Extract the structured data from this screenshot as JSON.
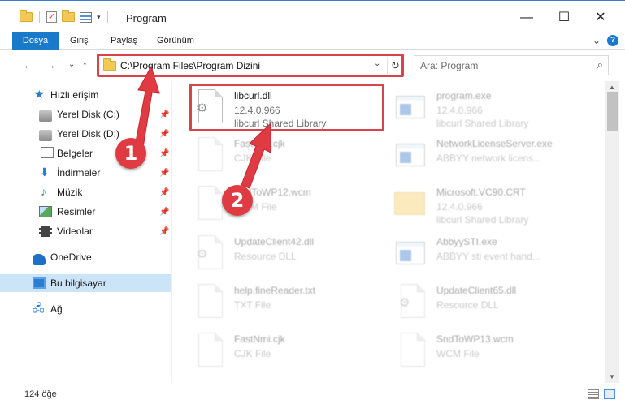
{
  "window": {
    "title": "Program",
    "minimize": "—",
    "maximize": "☐",
    "close": "✕"
  },
  "ribbon": {
    "tabs": [
      "Dosya",
      "Giriş",
      "Paylaş",
      "Görünüm"
    ],
    "expand": "⌄",
    "help": "?"
  },
  "nav": {
    "back": "←",
    "forward": "→",
    "recent": "⌄",
    "up": "↑"
  },
  "address": {
    "path": "C:\\Program Files\\Program Dizini",
    "dropdown": "⌄",
    "refresh": "↻"
  },
  "search": {
    "placeholder": "Ara: Program",
    "icon": "search-icon"
  },
  "sidebar": {
    "items": [
      {
        "label": "Hızlı erişim",
        "icon": "quick-access-star-icon",
        "pinned": false
      },
      {
        "label": "Yerel Disk (C:)",
        "icon": "disk-icon",
        "pinned": true
      },
      {
        "label": "Yerel Disk (D:)",
        "icon": "disk-icon",
        "pinned": true
      },
      {
        "label": "Belgeler",
        "icon": "documents-icon",
        "pinned": true
      },
      {
        "label": "İndirmeler",
        "icon": "downloads-icon",
        "pinned": true
      },
      {
        "label": "Müzik",
        "icon": "music-icon",
        "pinned": true
      },
      {
        "label": "Resimler",
        "icon": "pictures-icon",
        "pinned": true
      },
      {
        "label": "Videolar",
        "icon": "videos-icon",
        "pinned": true
      },
      {
        "label": "OneDrive",
        "icon": "onedrive-icon",
        "pinned": false
      },
      {
        "label": "Bu bilgisayar",
        "icon": "this-pc-icon",
        "pinned": false,
        "selected": true
      },
      {
        "label": "Ağ",
        "icon": "network-icon",
        "pinned": false
      }
    ]
  },
  "files": [
    {
      "name": "libcurl.dll",
      "line2": "12.4.0.966",
      "line3": "libcurl Shared Library",
      "icon": "dll-gear-icon",
      "highlighted": true
    },
    {
      "name": "program.exe",
      "line2": "12.4.0.966",
      "line3": "libcurl Shared Library",
      "icon": "exe-icon"
    },
    {
      "name": "FastNmi.cjk",
      "line2": "CJK File",
      "line3": "",
      "icon": "file-icon"
    },
    {
      "name": "NetworkLicenseServer.exe",
      "line2": "ABBYY network licens...",
      "line3": "",
      "icon": "exe-icon"
    },
    {
      "name": "SndToWP12.wcm",
      "line2": "WCM File",
      "line3": "",
      "icon": "file-icon"
    },
    {
      "name": "Microsoft.VC90.CRT",
      "line2": "12.4.0.966",
      "line3": "libcurl Shared Library",
      "icon": "folder-icon"
    },
    {
      "name": "UpdateClient42.dll",
      "line2": "Resource DLL",
      "line3": "",
      "icon": "dll-gear-icon"
    },
    {
      "name": "AbbyySTI.exe",
      "line2": "ABBYY sti event hand...",
      "line3": "",
      "icon": "exe-icon"
    },
    {
      "name": "help.fineReader.txt",
      "line2": "TXT File",
      "line3": "",
      "icon": "file-icon"
    },
    {
      "name": "UpdateClient65.dll",
      "line2": "Resource DLL",
      "line3": "",
      "icon": "dll-gear-icon"
    },
    {
      "name": "FastNmi.cjk",
      "line2": "CJK File",
      "line3": "",
      "icon": "file-icon"
    },
    {
      "name": "SndToWP13.wcm",
      "line2": "WCM File",
      "line3": "",
      "icon": "file-icon"
    }
  ],
  "annotations": {
    "badge1": "1",
    "badge2": "2",
    "color": "#e03a42"
  },
  "status": {
    "item_count": "124 öğe"
  },
  "colors": {
    "accent": "#1979ca",
    "selection": "#cce4f7",
    "highlight": "#d9434b"
  }
}
